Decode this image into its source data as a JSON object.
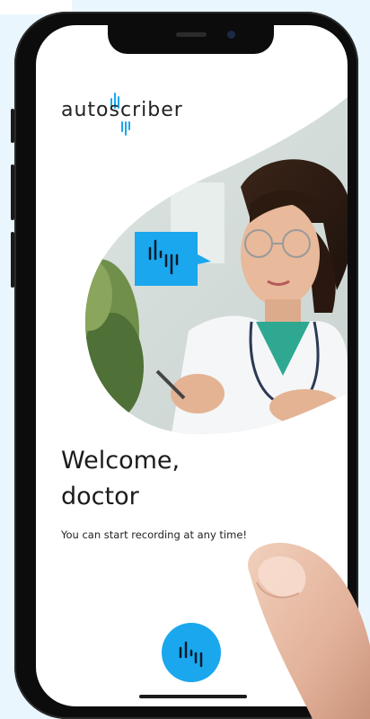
{
  "app": {
    "logo_text": "autoscriber"
  },
  "welcome": {
    "line1": "Welcome,",
    "line2": "doctor",
    "subtitle": "You can start recording at any time!"
  },
  "colors": {
    "accent": "#1aa7ee",
    "background": "#e9f6fd"
  },
  "icons": {
    "record_button": "waveform-icon",
    "chat_bubble": "waveform-speech-bubble-icon"
  }
}
